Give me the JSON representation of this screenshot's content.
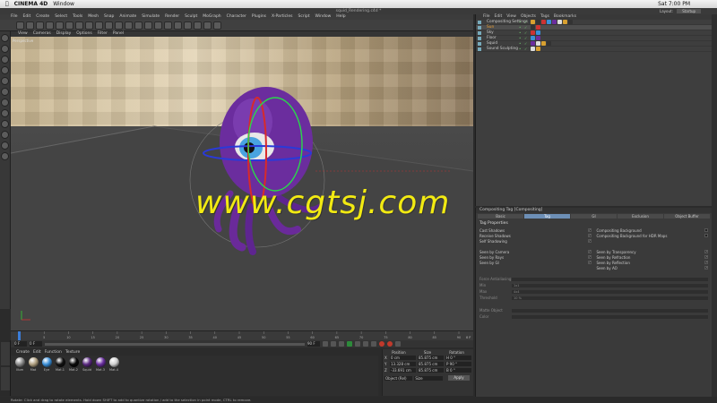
{
  "mac_menubar": {
    "app": "CINEMA 4D",
    "window": "Window",
    "clock": "Sat 7:00 PM"
  },
  "window_title": "squid_Rendering.c4d *",
  "layout": {
    "label": "Layout:",
    "value": "Startup"
  },
  "main_menu": [
    "File",
    "Edit",
    "Create",
    "Select",
    "Tools",
    "Mesh",
    "Snap",
    "Animate",
    "Simulate",
    "Render",
    "Sculpt",
    "MoGraph",
    "Character",
    "Plugins",
    "X-Particles",
    "Script",
    "Window",
    "Help"
  ],
  "viewport": {
    "menu": [
      "View",
      "Cameras",
      "Display",
      "Options",
      "Filter",
      "Panel"
    ],
    "label": "Perspective"
  },
  "watermark": "www.cgtsj.com",
  "timeline": {
    "ticks": [
      "0",
      "5",
      "10",
      "15",
      "20",
      "25",
      "30",
      "35",
      "40",
      "45",
      "50",
      "55",
      "60",
      "65",
      "70",
      "75",
      "80",
      "85",
      "90"
    ],
    "end_label": "0 F",
    "current": "0 F",
    "min": "0 F",
    "max": "90 F",
    "end": "90 F"
  },
  "material_menu": [
    "Create",
    "Edit",
    "Function",
    "Texture"
  ],
  "materials": [
    {
      "name": "Illum",
      "color": "#8a8a8a"
    },
    {
      "name": "Mat",
      "color": "#b0a080"
    },
    {
      "name": "Eye",
      "color": "#3a8fd8"
    },
    {
      "name": "Mat.1",
      "color": "#111111"
    },
    {
      "name": "Mat.2",
      "color": "#0a0a0a"
    },
    {
      "name": "Squid",
      "color": "#5a2a80"
    },
    {
      "name": "Mat.3",
      "color": "#6a2fa0"
    },
    {
      "name": "Mat.4",
      "color": "#cfcfcf"
    }
  ],
  "coordinates": {
    "headers": [
      "Position",
      "Size",
      "Rotation"
    ],
    "rows": [
      {
        "axis": "X",
        "pos": "0 cm",
        "size": "85.875 cm",
        "rot": "H 0 °"
      },
      {
        "axis": "Y",
        "pos": "13.328 cm",
        "size": "85.875 cm",
        "rot": "P 90 °"
      },
      {
        "axis": "Z",
        "pos": "-33.691 cm",
        "size": "85.875 cm",
        "rot": "B 0 °"
      }
    ],
    "mode": "Object (Rel)",
    "size_mode": "Size",
    "apply": "Apply"
  },
  "status": "Rotate: Click and drag to rotate elements. Hold down SHIFT to add to quantize rotation / add to the selection in point mode, CTRL to remove.",
  "object_manager": {
    "menu": [
      "File",
      "Edit",
      "View",
      "Objects",
      "Tags",
      "Bookmarks"
    ],
    "objects": [
      {
        "name": "Compositing Settings",
        "selected": false
      },
      {
        "name": "Sun",
        "selected": true
      },
      {
        "name": "Sky",
        "selected": false
      },
      {
        "name": "Floor",
        "selected": false
      },
      {
        "name": "Squid",
        "selected": false
      },
      {
        "name": "Sound Sculpting",
        "selected": false
      }
    ]
  },
  "attributes": {
    "header": "Compositing Tag [Compositing]",
    "tabs": [
      "Basic",
      "Tag",
      "GI",
      "Exclusion",
      "Object Buffer"
    ],
    "active_tab": "Tag",
    "title": "Tag Properties",
    "left_props": [
      {
        "label": "Cast Shadows",
        "check": "✓"
      },
      {
        "label": "Receive Shadows",
        "check": "✓"
      },
      {
        "label": "Self Shadowing",
        "check": "✓"
      },
      {
        "label": "",
        "check": ""
      },
      {
        "label": "Seen by Camera",
        "check": "✓"
      },
      {
        "label": "Seen by Rays",
        "check": "✓"
      },
      {
        "label": "Seen by GI",
        "check": "✓"
      }
    ],
    "right_props": [
      {
        "label": "Compositing Background",
        "check": ""
      },
      {
        "label": "Compositing Background for HDR Maps",
        "check": ""
      },
      {
        "label": "",
        "check": ""
      },
      {
        "label": "",
        "check": ""
      },
      {
        "label": "Seen by Transparency",
        "check": "✓"
      },
      {
        "label": "Seen by Refraction",
        "check": "✓"
      },
      {
        "label": "Seen by Reflection",
        "check": "✓"
      },
      {
        "label": "Seen by AO",
        "check": "✓"
      }
    ],
    "sliders": [
      {
        "label": "Force Antialiasing",
        "value": ""
      },
      {
        "label": "Min",
        "value": "1x1"
      },
      {
        "label": "Max",
        "value": "4x4"
      },
      {
        "label": "Threshold",
        "value": "10 %"
      },
      {
        "label": "",
        "value": ""
      },
      {
        "label": "Matte Object",
        "value": ""
      },
      {
        "label": "Color",
        "value": ""
      }
    ]
  }
}
